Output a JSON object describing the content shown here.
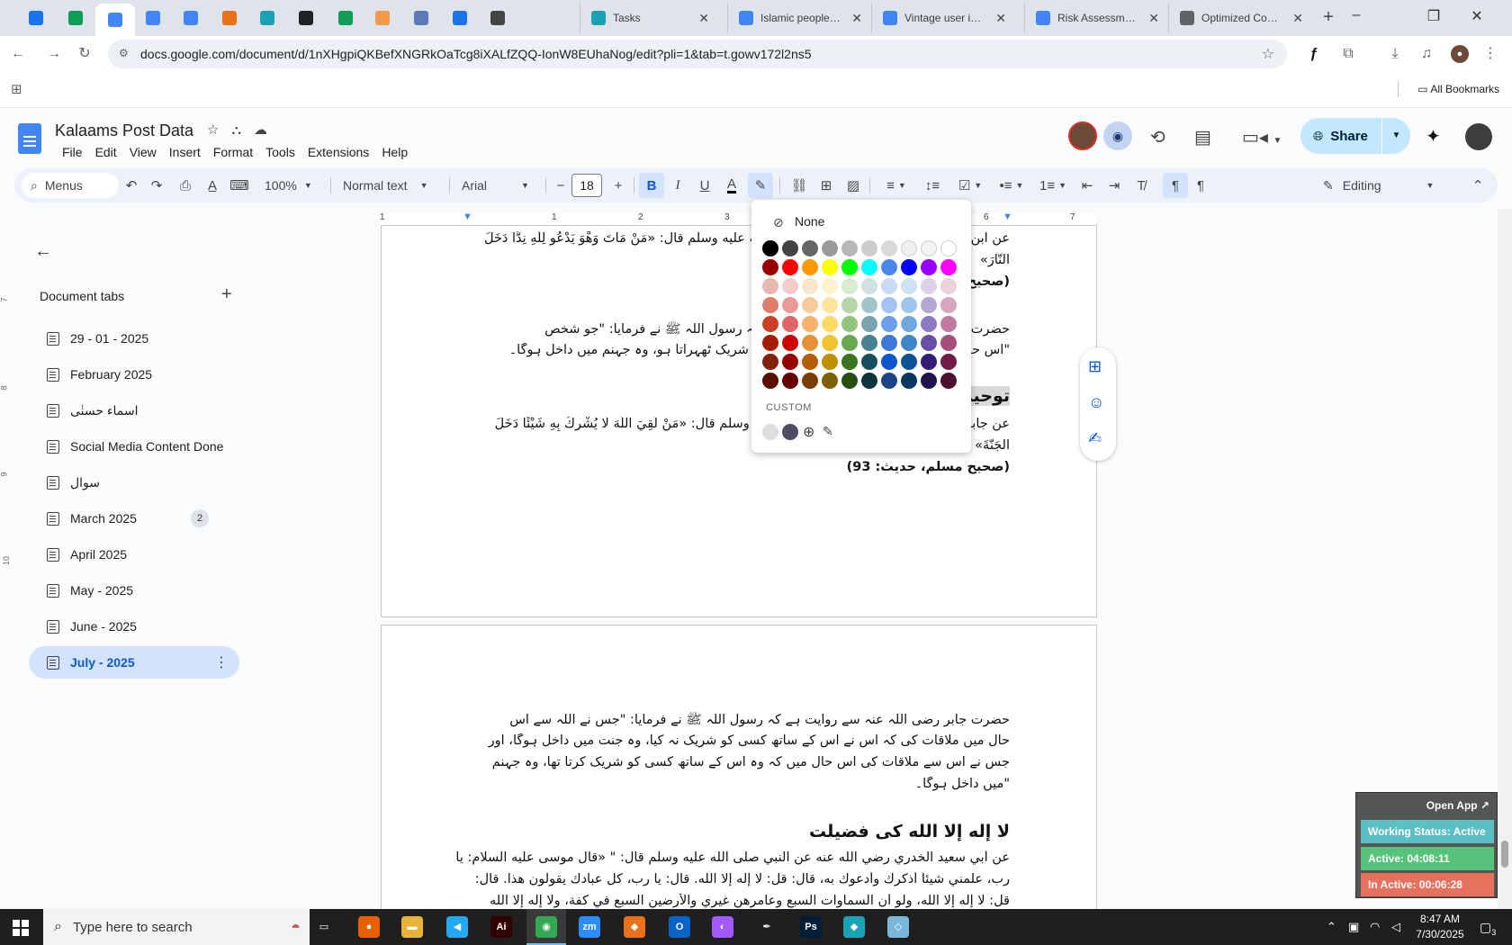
{
  "browser": {
    "pinned_tabs": [
      {
        "icon": "vpn-shield-icon",
        "color": "#1a73e8"
      },
      {
        "icon": "sheets-icon",
        "color": "#0f9d58"
      },
      {
        "icon": "docs-icon",
        "color": "#4285f4"
      },
      {
        "icon": "docs-icon",
        "color": "#4285f4"
      },
      {
        "icon": "docs-icon",
        "color": "#4285f4"
      },
      {
        "icon": "drawio-icon",
        "color": "#e8711a"
      },
      {
        "icon": "app-icon",
        "color": "#1aa3b5"
      },
      {
        "icon": "openai-icon",
        "color": "#202124"
      },
      {
        "icon": "sheets-icon",
        "color": "#0f9d58"
      },
      {
        "icon": "hand-icon",
        "color": "#f2994a"
      },
      {
        "icon": "grid-icon",
        "color": "#5b7bb8"
      },
      {
        "icon": "forms-icon",
        "color": "#1a73e8"
      },
      {
        "icon": "speaker-icon",
        "color": "#444444"
      }
    ],
    "tabs": [
      {
        "title": "Tasks",
        "icon_color": "#1aa3b5"
      },
      {
        "title": "Islamic people an",
        "icon_color": "#4285f4"
      },
      {
        "title": "Vintage user inter",
        "icon_color": "#4285f4"
      },
      {
        "title": "Risk Assessment",
        "icon_color": "#4285f4"
      },
      {
        "title": "Optimized Cost E",
        "icon_color": "#5f6368"
      }
    ],
    "new_tab": "+",
    "window_controls": [
      "–",
      "❐",
      "✕"
    ],
    "url": "docs.google.com/document/d/1nXHgpiQKBefXNGRkOaTcg8iXALfZQQ-IonW8EUhaNog/edit?pli=1&tab=t.gowv172l2ns5",
    "all_bookmarks": "All Bookmarks"
  },
  "doc": {
    "title": "Kalaams Post Data",
    "menus": [
      "File",
      "Edit",
      "View",
      "Insert",
      "Format",
      "Tools",
      "Extensions",
      "Help"
    ],
    "share_label": "Share"
  },
  "toolbar": {
    "menus_search": "Menus",
    "zoom": "100%",
    "style": "Normal text",
    "font": "Arial",
    "font_size": "18",
    "mode": "Editing",
    "text_color_bar": "#000000"
  },
  "ruler": {
    "numbers": [
      "1",
      "1",
      "2",
      "3",
      "4",
      "5",
      "6",
      "7"
    ],
    "vertical_numbers": [
      "7",
      "8",
      "9",
      "10"
    ]
  },
  "sidebar": {
    "title": "Document tabs",
    "tabs": [
      {
        "label": "29 - 01 - 2025"
      },
      {
        "label": "February 2025"
      },
      {
        "label": "اسماء حسنٰی"
      },
      {
        "label": "Social Media Content Done"
      },
      {
        "label": "سوال"
      },
      {
        "label": "March 2025",
        "badge": "2"
      },
      {
        "label": "April 2025"
      },
      {
        "label": "May - 2025"
      },
      {
        "label": "June - 2025"
      },
      {
        "label": "July - 2025",
        "selected": true
      }
    ]
  },
  "page1": {
    "line1": "عن ابن عمر رضي الله عنهما عن النبي صلى الله عليه وسلم قال: «مَنْ مَاتَ وَهْوَ يَدْعُو لِلَّهِ نِدًّا دَخَلَ",
    "line2": "النَّارَ»",
    "line3": "(صحيح البخاري)",
    "line4": "حضرت ابن عمر رضی اللہ عنہ سے روایت ہے کہ رسول اللہ ﷺ نے فرمایا: \"جو شخص",
    "line5": "\"اس حال میں مرا کہ وہ اللہ کے ساتھ کسی کو شریک ٹھہراتا ہو، وہ جہنم میں داخل ہوگا۔",
    "heading": "توحید",
    "line6": "عن جابر رضي الله عنه عن النبي صلى الله عليه وسلم قال: «مَنْ لَقِيَ اللَّهَ لَا يُشْرِكُ بِهِ شَيْئًا دَخَلَ",
    "line7": "الْجَنَّةَ»",
    "line8": "(صحيح مسلم، حديث: 93)"
  },
  "page2": {
    "para1": [
      "حضرت جابر رضی اللہ عنہ سے روایت ہے کہ رسول اللہ ﷺ نے فرمایا: \"جس نے اللہ سے اس",
      "حال میں ملاقات کی کہ اس نے اس کے ساتھ کسی کو شریک نہ کیا، وہ جنت میں داخل ہوگا، اور",
      "جس نے اس سے ملاقات کی اس حال میں کہ وہ اس کے ساتھ کسی کو شریک کرتا تھا، وہ جہنم",
      "\"میں داخل ہوگا۔"
    ],
    "heading": "لا إله إلا الله کی فضیلت",
    "para2": [
      "عن أبي سعيد الخدري رضي الله عنه عن النبي صلى الله عليه وسلم قال: \" «قال موسى عليه السلام: يا",
      "رب، علمني شيئاً أذكرك وأدعوك به، قال: قل: لا إله إلا الله. قال: يا رب، كل عبادك يقولون هذا. قال:",
      "قل: لا إله إلا الله، ولو أن السماوات السبع وعامرهن غيري والأرضين السبع في كفة، ولا إله إلا الله"
    ]
  },
  "color_popup": {
    "none_label": "None",
    "custom_label": "CUSTOM",
    "rows": [
      [
        "#000000",
        "#434343",
        "#666666",
        "#999999",
        "#b7b7b7",
        "#cccccc",
        "#d9d9d9",
        "#efefef",
        "#f3f3f3",
        "#ffffff"
      ],
      [
        "#980000",
        "#ff0000",
        "#ff9900",
        "#ffff00",
        "#00ff00",
        "#00ffff",
        "#4a86e8",
        "#0000ff",
        "#9900ff",
        "#ff00ff"
      ],
      [
        "#e6b8af",
        "#f4cccc",
        "#fce5cd",
        "#fff2cc",
        "#d9ead3",
        "#d0e0e3",
        "#c9daf8",
        "#cfe2f3",
        "#d9d2e9",
        "#ead1dc"
      ],
      [
        "#dd7e6b",
        "#ea9999",
        "#f9cb9c",
        "#ffe599",
        "#b6d7a8",
        "#a2c4c9",
        "#a4c2f4",
        "#9fc5e8",
        "#b4a7d6",
        "#d5a6bd"
      ],
      [
        "#cc4125",
        "#e06666",
        "#f6b26b",
        "#ffd966",
        "#93c47d",
        "#76a5af",
        "#6d9eeb",
        "#6fa8dc",
        "#8e7cc3",
        "#c27ba0"
      ],
      [
        "#a61c00",
        "#cc0000",
        "#e69138",
        "#f1c232",
        "#6aa84f",
        "#45818e",
        "#3c78d8",
        "#3d85c6",
        "#674ea7",
        "#a64d79"
      ],
      [
        "#85200c",
        "#990000",
        "#b45f06",
        "#bf9000",
        "#38761d",
        "#134f5c",
        "#1155cc",
        "#0b5394",
        "#351c75",
        "#741b47"
      ],
      [
        "#5b0f00",
        "#660000",
        "#783f04",
        "#7f6000",
        "#274e13",
        "#0c343d",
        "#1c4587",
        "#073763",
        "#20124d",
        "#4c1130"
      ]
    ],
    "custom": [
      "#dddddd",
      "#4f4f63"
    ]
  },
  "widget": {
    "open_app": "Open App ↗",
    "status": "Working Status: Active",
    "active": "Active: 04:08:11",
    "inactive": "In Active: 00:06:28",
    "status_color": "#5bbfc4",
    "active_color": "#57c27a",
    "inactive_color": "#e8705e"
  },
  "taskbar": {
    "search_placeholder": "Type here to search",
    "time": "8:47 AM",
    "date": "7/30/2025",
    "notification_count": "3",
    "apps": [
      {
        "icon": "task-view-icon",
        "color": "#1f1f1f",
        "glyph": "▭"
      },
      {
        "icon": "firefox-icon",
        "color": "#e66000",
        "glyph": "●"
      },
      {
        "icon": "file-explorer-icon",
        "color": "#e8b339",
        "glyph": "▬"
      },
      {
        "icon": "vscode-icon",
        "color": "#23a9f2",
        "glyph": "◀"
      },
      {
        "icon": "illustrator-icon",
        "color": "#330000",
        "glyph": "Ai"
      },
      {
        "icon": "chrome-icon",
        "color": "#34a853",
        "glyph": "◉"
      },
      {
        "icon": "zoom-icon",
        "color": "#2d8cff",
        "glyph": "zm"
      },
      {
        "icon": "drawio-icon",
        "color": "#e8711a",
        "glyph": "◆"
      },
      {
        "icon": "outlook-icon",
        "color": "#0a64c8",
        "glyph": "O"
      },
      {
        "icon": "figma-icon",
        "color": "#a259ff",
        "glyph": "◐"
      },
      {
        "icon": "inkscape-icon",
        "color": "#1f1f1f",
        "glyph": "✒"
      },
      {
        "icon": "photoshop-icon",
        "color": "#001e36",
        "glyph": "Ps"
      },
      {
        "icon": "app-icon",
        "color": "#1aa3b5",
        "glyph": "◆"
      },
      {
        "icon": "app2-icon",
        "color": "#7ab8d9",
        "glyph": "◇"
      }
    ]
  }
}
